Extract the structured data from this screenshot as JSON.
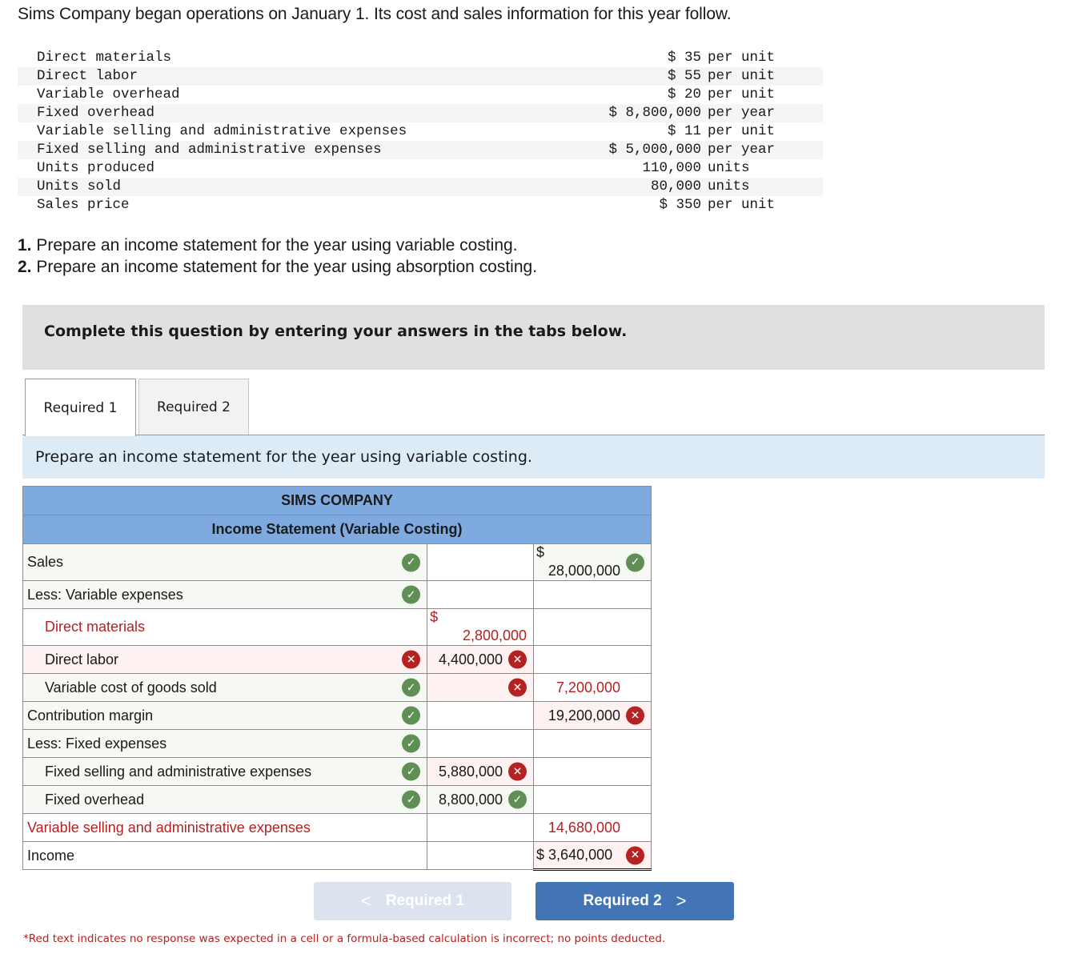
{
  "intro": "Sims Company began operations on January 1. Its cost and sales information for this year follow.",
  "given_data": [
    {
      "label": "Direct materials",
      "amount": "$ 35",
      "unit": "per unit"
    },
    {
      "label": "Direct labor",
      "amount": "$ 55",
      "unit": "per unit"
    },
    {
      "label": "Variable overhead",
      "amount": "$ 20",
      "unit": "per unit"
    },
    {
      "label": "Fixed overhead",
      "amount": "$ 8,800,000",
      "unit": "per year"
    },
    {
      "label": "Variable selling and administrative expenses",
      "amount": "$ 11",
      "unit": "per unit"
    },
    {
      "label": "Fixed selling and administrative expenses",
      "amount": "$ 5,000,000",
      "unit": "per year"
    },
    {
      "label": "Units produced",
      "amount": "110,000",
      "unit": "units"
    },
    {
      "label": "Units sold",
      "amount": "80,000",
      "unit": "units"
    },
    {
      "label": "Sales price",
      "amount": "$ 350",
      "unit": "per unit"
    }
  ],
  "requirements": [
    {
      "num": "1.",
      "text": " Prepare an income statement for the year using variable costing."
    },
    {
      "num": "2.",
      "text": " Prepare an income statement for the year using absorption costing."
    }
  ],
  "instruction": "Complete this question by entering your answers in the tabs below.",
  "tabs": [
    {
      "label": "Required 1",
      "active": true
    },
    {
      "label": "Required 2",
      "active": false
    }
  ],
  "prompt": "Prepare an income statement for the year using variable costing.",
  "statement": {
    "company": "SIMS COMPANY",
    "title": "Income Statement (Variable Costing)",
    "rows": [
      {
        "label": "Sales",
        "label_status": "correct",
        "col1": "",
        "col2_dollar": "$",
        "col2": "28,000,000",
        "col2_status": "correct"
      },
      {
        "label": "Less: Variable expenses",
        "label_status": "correct",
        "col1": "",
        "col2": ""
      },
      {
        "label": "Direct materials",
        "label_red": true,
        "col1_dollar": "$",
        "col1": "2,800,000",
        "col1_red": true,
        "col2": ""
      },
      {
        "label": "Direct labor",
        "label_status": "incorrect",
        "col1": "4,400,000",
        "col1_status": "incorrect",
        "col2": ""
      },
      {
        "label": "Variable cost of goods sold",
        "label_status": "correct",
        "col1": "",
        "col1_status": "incorrect",
        "col2": "7,200,000",
        "col2_red": true
      },
      {
        "label": "Contribution margin",
        "label_status": "correct",
        "col1": "",
        "col2": "19,200,000",
        "col2_status": "incorrect"
      },
      {
        "label": "Less: Fixed expenses",
        "label_status": "correct",
        "col1": "",
        "col2": ""
      },
      {
        "label": "Fixed selling and administrative expenses",
        "label_status": "correct",
        "col1": "5,880,000",
        "col1_status": "incorrect",
        "col2": ""
      },
      {
        "label": "Fixed overhead",
        "label_status": "correct",
        "col1": "8,800,000",
        "col1_status": "correct",
        "col2": ""
      },
      {
        "label": "Variable selling and administrative expenses",
        "label_red": true,
        "col1": "",
        "col2": "14,680,000",
        "col2_red": true
      },
      {
        "label": "Income",
        "col1": "",
        "col2": "$ 3,640,000",
        "col2_status": "incorrect"
      }
    ]
  },
  "nav": {
    "prev_label": "Required 1",
    "next_label": "Required 2",
    "prev_chevron": "<",
    "next_chevron": ">"
  },
  "icons": {
    "correct": "✓",
    "incorrect": "✕"
  },
  "footnote": "*Red text indicates no response was expected in a cell or a formula-based calculation is incorrect; no points deducted."
}
